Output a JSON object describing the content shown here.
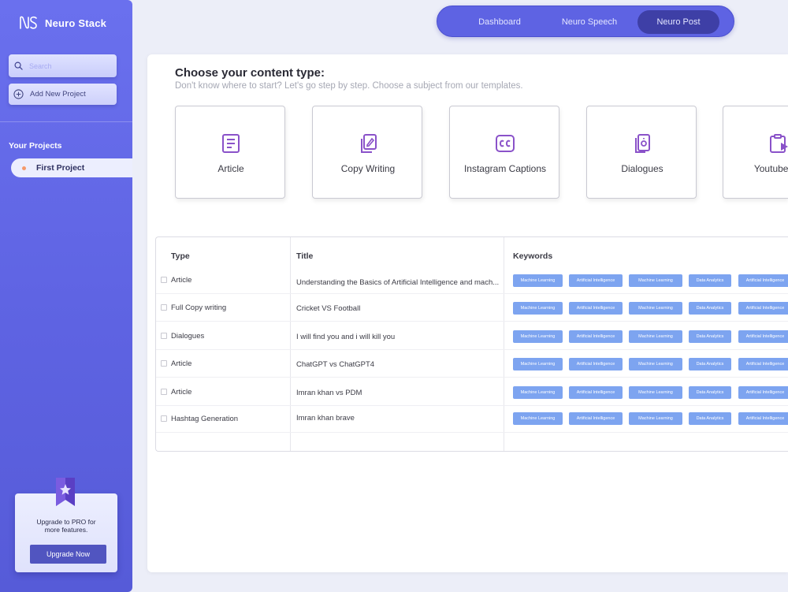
{
  "app": {
    "name": "Neuro Stack",
    "logo_text": "NS"
  },
  "sidebar": {
    "search_placeholder": "Search",
    "add_project_label": "Add New Project",
    "section_title": "Your Projects",
    "projects": [
      {
        "label": "First Project"
      }
    ],
    "upgrade": {
      "text": "Upgrade to PRO for more features.",
      "button_label": "Upgrade Now"
    }
  },
  "topnav": {
    "tabs": [
      {
        "label": "Dashboard"
      },
      {
        "label": "Neuro Speech"
      },
      {
        "label": "Neuro Post",
        "active": true
      }
    ]
  },
  "main": {
    "heading": "Choose your content type:",
    "subheading": "Don't know where to start? Let's go step by step. Choose a subject from our templates.",
    "content_types": [
      {
        "label": "Article",
        "icon": "article-icon"
      },
      {
        "label": "Copy Writing",
        "icon": "copy-writing-icon"
      },
      {
        "label": "Instagram Captions",
        "icon": "captions-icon"
      },
      {
        "label": "Dialogues",
        "icon": "dialogues-icon"
      },
      {
        "label": "Youtube Co",
        "icon": "youtube-clipboard-icon"
      }
    ],
    "table": {
      "headers": {
        "type": "Type",
        "title": "Title",
        "keywords": "Keywords"
      },
      "keywords": [
        "Machine Learning",
        "Artificial Intelligence",
        "Machine Learning",
        "Data Analytics",
        "Artificial Intelligence"
      ],
      "rows": [
        {
          "type": "Article",
          "title": "Understanding the Basics of Artificial Intelligence and mach..."
        },
        {
          "type": "Full Copy writing",
          "title": "Cricket VS Football"
        },
        {
          "type": "Dialogues",
          "title": "I will find you and i will kill you"
        },
        {
          "type": "Article",
          "title": "ChatGPT vs ChatGPT4"
        },
        {
          "type": "Article",
          "title": "Imran khan vs PDM"
        },
        {
          "type": "Hashtag Generation",
          "title": "Imran khan brave"
        }
      ]
    }
  },
  "colors": {
    "sidebar": "#6a70ee",
    "accent": "#5e63e3",
    "active_tab": "#3e3fa6",
    "chip": "#7da4f0",
    "icon": "#8a52c9",
    "dot": "#f59a6b"
  }
}
